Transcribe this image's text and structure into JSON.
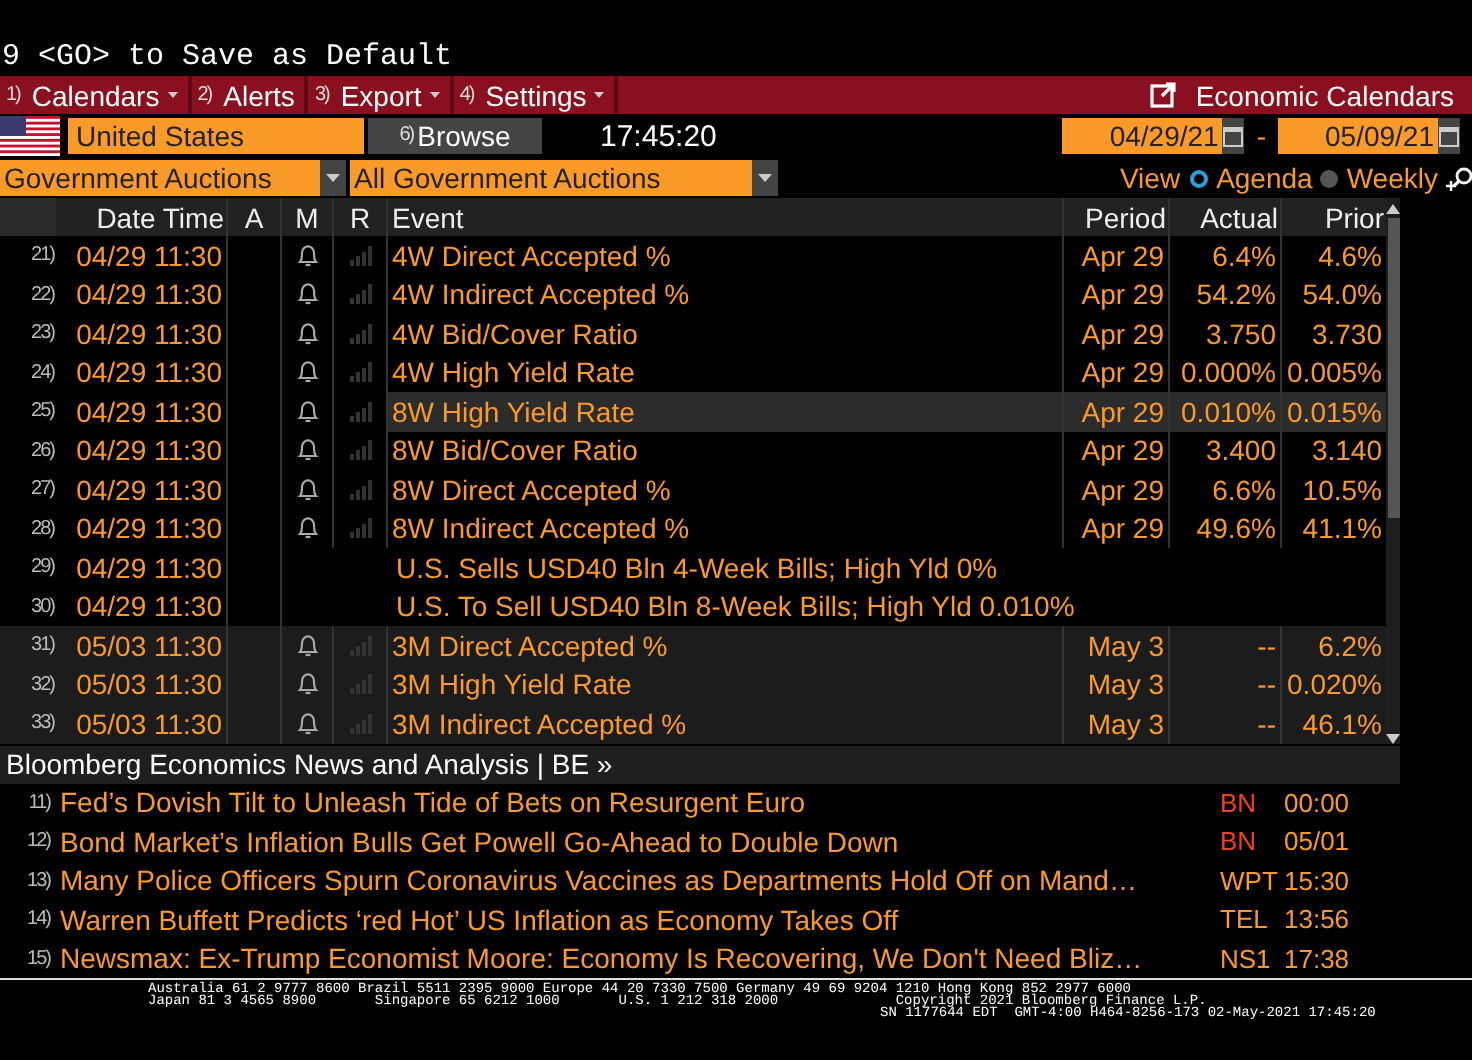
{
  "command_line": "9 <GO> to Save as Default",
  "menu": [
    {
      "number": "1)",
      "label": "Calendars",
      "dropdown": true
    },
    {
      "number": "2)",
      "label": "Alerts",
      "dropdown": false
    },
    {
      "number": "3)",
      "label": "Export",
      "dropdown": true
    },
    {
      "number": "4)",
      "label": "Settings",
      "dropdown": true
    }
  ],
  "title": "Economic Calendars",
  "country": {
    "value": "United States"
  },
  "browse": {
    "number": "6)",
    "label": "Browse"
  },
  "clock": "17:45:20",
  "date_from": "04/29/21",
  "date_separator": "-",
  "date_to": "05/09/21",
  "filters": [
    {
      "value": "Government Auctions"
    },
    {
      "value": "All Government Auctions"
    }
  ],
  "view": {
    "label": "View",
    "options": [
      {
        "label": "Agenda",
        "selected": true
      },
      {
        "label": "Weekly",
        "selected": false
      }
    ]
  },
  "table": {
    "columns": [
      "Date Time",
      "A",
      "M",
      "R",
      "Event",
      "Period",
      "Actual",
      "Prior"
    ],
    "rows": [
      {
        "kind": "data",
        "number": "21)",
        "datetime": "04/29 11:30",
        "event": "4W Direct Accepted %",
        "period": "Apr 29",
        "actual": "6.4%",
        "prior": "4.6%",
        "selected": false,
        "upcoming": false
      },
      {
        "kind": "data",
        "number": "22)",
        "datetime": "04/29 11:30",
        "event": "4W Indirect Accepted %",
        "period": "Apr 29",
        "actual": "54.2%",
        "prior": "54.0%",
        "selected": false,
        "upcoming": false
      },
      {
        "kind": "data",
        "number": "23)",
        "datetime": "04/29 11:30",
        "event": "4W Bid/Cover Ratio",
        "period": "Apr 29",
        "actual": "3.750",
        "prior": "3.730",
        "selected": false,
        "upcoming": false
      },
      {
        "kind": "data",
        "number": "24)",
        "datetime": "04/29 11:30",
        "event": "4W High Yield Rate",
        "period": "Apr 29",
        "actual": "0.000%",
        "prior": "0.005%",
        "selected": false,
        "upcoming": false
      },
      {
        "kind": "data",
        "number": "25)",
        "datetime": "04/29 11:30",
        "event": "8W High Yield Rate",
        "period": "Apr 29",
        "actual": "0.010%",
        "prior": "0.015%",
        "selected": true,
        "upcoming": false
      },
      {
        "kind": "data",
        "number": "26)",
        "datetime": "04/29 11:30",
        "event": "8W Bid/Cover Ratio",
        "period": "Apr 29",
        "actual": "3.400",
        "prior": "3.140",
        "selected": false,
        "upcoming": false
      },
      {
        "kind": "data",
        "number": "27)",
        "datetime": "04/29 11:30",
        "event": "8W Direct Accepted %",
        "period": "Apr 29",
        "actual": "6.6%",
        "prior": "10.5%",
        "selected": false,
        "upcoming": false
      },
      {
        "kind": "data",
        "number": "28)",
        "datetime": "04/29 11:30",
        "event": "8W Indirect Accepted %",
        "period": "Apr 29",
        "actual": "49.6%",
        "prior": "41.1%",
        "selected": false,
        "upcoming": false
      },
      {
        "kind": "headline",
        "number": "29)",
        "datetime": "04/29 11:30",
        "event": "U.S. Sells USD40 Bln 4-Week Bills; High Yld 0%",
        "selected": false,
        "upcoming": false
      },
      {
        "kind": "headline",
        "number": "30)",
        "datetime": "04/29 11:30",
        "event": "U.S. To Sell USD40 Bln 8-Week Bills; High Yld 0.010%",
        "selected": false,
        "upcoming": false
      },
      {
        "kind": "data",
        "number": "31)",
        "datetime": "05/03 11:30",
        "event": "3M Direct Accepted %",
        "period": "May 3",
        "actual": "--",
        "prior": "6.2%",
        "selected": false,
        "upcoming": true
      },
      {
        "kind": "data",
        "number": "32)",
        "datetime": "05/03 11:30",
        "event": "3M High Yield Rate",
        "period": "May 3",
        "actual": "--",
        "prior": "0.020%",
        "selected": false,
        "upcoming": true
      },
      {
        "kind": "data",
        "number": "33)",
        "datetime": "05/03 11:30",
        "event": "3M Indirect Accepted %",
        "period": "May 3",
        "actual": "--",
        "prior": "46.1%",
        "selected": false,
        "upcoming": true
      }
    ]
  },
  "news": {
    "title": "Bloomberg Economics News and Analysis | BE »",
    "items": [
      {
        "number": "11)",
        "headline": "Fed’s Dovish Tilt to Unleash Tide of Bets on Resurgent Euro",
        "source": "BN",
        "color": "#f0401c",
        "time": "00:00"
      },
      {
        "number": "12)",
        "headline": "Bond Market’s Inflation Bulls Get Powell Go-Ahead to Double Down",
        "source": "BN",
        "color": "#f0401c",
        "time": "05/01"
      },
      {
        "number": "13)",
        "headline": "Many Police Officers Spurn Coronavirus Vaccines as Departments Hold Off on Mand…",
        "source": "WPT",
        "color": "#fa9a28",
        "time": "15:30"
      },
      {
        "number": "14)",
        "headline": "Warren Buffett Predicts ‘red Hot’ US Inflation as Economy Takes Off",
        "source": "TEL",
        "color": "#fa9a28",
        "time": "13:56"
      },
      {
        "number": "15)",
        "headline": "Newsmax: Ex-Trump Economist Moore: Economy Is Recovering, We Don't Need Bliz…",
        "source": "NS1",
        "color": "#fa9a28",
        "time": "17:38"
      }
    ]
  },
  "footer": [
    "Australia 61 2 9777 8600 Brazil 5511 2395 9000 Europe 44 20 7330 7500 Germany 49 69 9204 1210 Hong Kong 852 2977 6000",
    "Japan 81 3 4565 8900       Singapore 65 6212 1000       U.S. 1 212 318 2000              Copyright 2021 Bloomberg Finance L.P.",
    "SN 1177644 EDT  GMT-4:00 H464-8256-173 02-May-2021 17:45:20"
  ]
}
